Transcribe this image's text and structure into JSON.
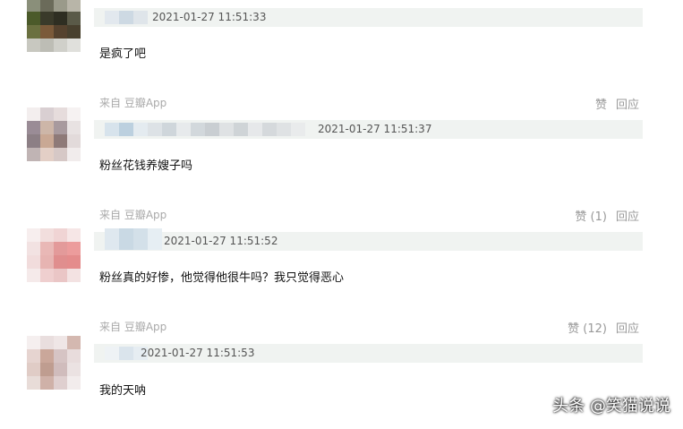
{
  "comments": [
    {
      "timestamp": "2021-01-27 11:51:33",
      "text": "是疯了吧",
      "source": "来自 豆瓣App",
      "like_label": "赞",
      "reply_label": "回应"
    },
    {
      "timestamp": "2021-01-27 11:51:37",
      "text": "粉丝花钱养嫂子吗",
      "source": "来自 豆瓣App",
      "like_label": "赞 (1)",
      "reply_label": "回应"
    },
    {
      "timestamp": "2021-01-27 11:51:52",
      "text": "粉丝真的好惨，他觉得他很牛吗？我只觉得恶心",
      "source": "来自 豆瓣App",
      "like_label": "赞 (12)",
      "reply_label": "回应"
    },
    {
      "timestamp": "2021-01-27 11:51:53",
      "text": "我的天呐"
    }
  ],
  "watermark": "头条 @笑猫说说",
  "colors": {
    "meta_bar": "#f0f3f1",
    "source_text": "#aaaaaa",
    "action_text": "#999999"
  }
}
